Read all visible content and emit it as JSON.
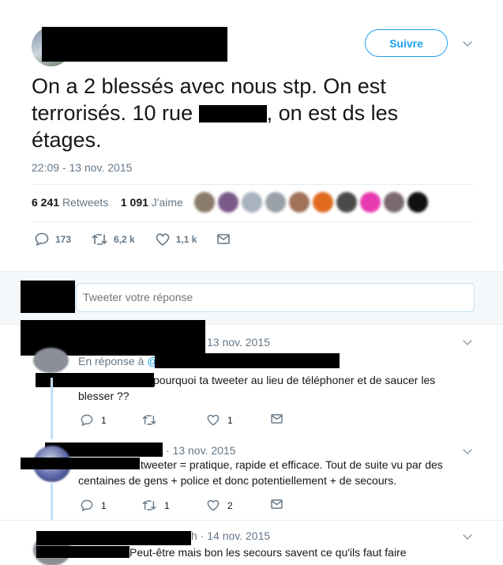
{
  "tweet": {
    "follow_label": "Suivre",
    "text_before": "On a 2 blessés avec nous stp.  On est terrorisés. 10 rue ",
    "text_after": ", on est ds les étages.",
    "timestamp": "22:09 - 13 nov. 2015",
    "retweets_count": "6 241",
    "retweets_label": "Retweets",
    "likes_count": "1 091",
    "likes_label": "J'aime",
    "actions": {
      "replies": "173",
      "retweets": "6,2 k",
      "likes": "1,1 k"
    },
    "liker_colors": [
      "#8a7a6a",
      "#7b5a8a",
      "#a9b3c0",
      "#9aa0a8",
      "#a0725a",
      "#e06a20",
      "#4a4a4a",
      "#e83ab0",
      "#7a6a70",
      "#111111"
    ]
  },
  "reply_box": {
    "placeholder": "Tweeter votre réponse"
  },
  "replies": [
    {
      "date": "13 nov. 2015",
      "in_reply_prefix": "En réponse à",
      "in_reply_handle": "@",
      "text_line1": "pourquoi ta tweeter au lieu de téléphoner et de saucer les",
      "text_line2": "blesser ??",
      "replies": "1",
      "likes": "1"
    },
    {
      "date": "· 13 nov. 2015",
      "text_line1": "tweeter = pratique, rapide et efficace. Tout de suite vu par des",
      "text_line2": "centaines de gens + police et donc potentiellement + de secours.",
      "replies": "1",
      "retweets": "1",
      "likes": "2"
    },
    {
      "date_prefix": "h",
      "date": "· 14 nov. 2015",
      "text_line1": "Peut-être mais bon les secours savent ce qu'ils faut faire"
    }
  ]
}
